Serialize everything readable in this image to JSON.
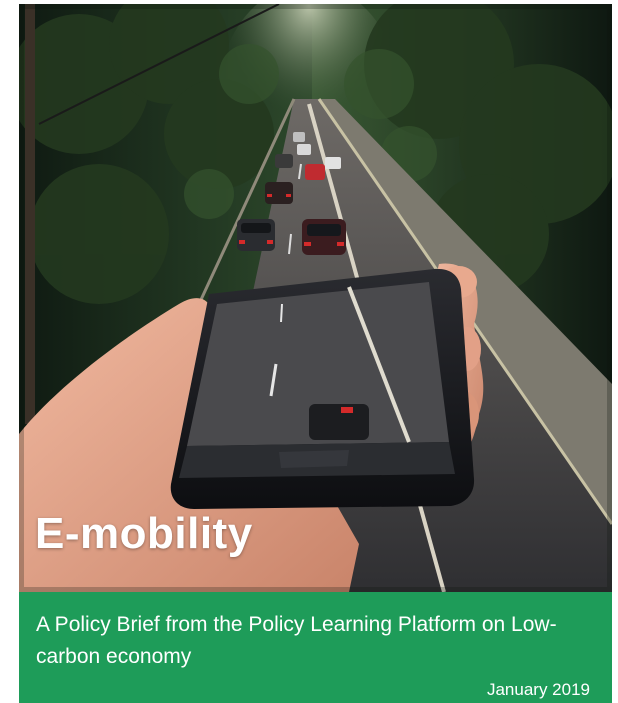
{
  "cover": {
    "title": "E-mobility",
    "subtitle": "A Policy Brief from the Policy Learning Platform on Low-carbon economy",
    "date": "January 2019"
  },
  "colors": {
    "band": "#1e9c59",
    "title_text": "#ffffff"
  }
}
